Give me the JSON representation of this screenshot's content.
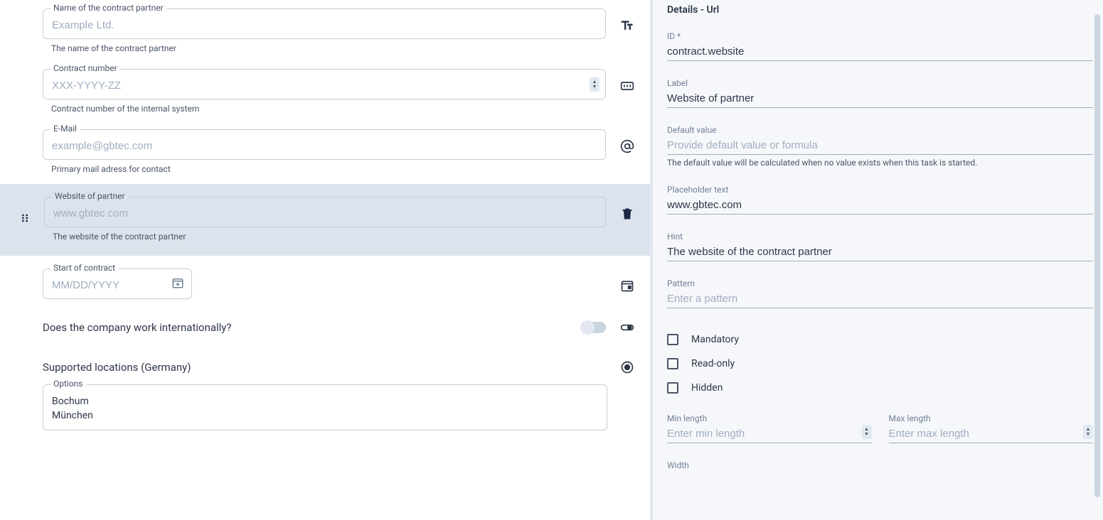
{
  "form": {
    "fields": [
      {
        "label": "Name of the contract partner",
        "placeholder": "Example Ltd.",
        "hint": "The name of the contract partner",
        "icon": "text-size-icon"
      },
      {
        "label": "Contract number",
        "placeholder": "XXX-YYYY-ZZ",
        "hint": "Contract number of the internal system",
        "icon": "number-icon"
      },
      {
        "label": "E-Mail",
        "placeholder": "example@gbtec.com",
        "hint": "Primary mail adress for contact",
        "icon": "at-icon"
      },
      {
        "label": "Website of partner",
        "placeholder": "www.gbtec.com",
        "hint": "The website of the contract partner",
        "icon": "trash-icon",
        "selected": true
      },
      {
        "label": "Start of contract",
        "placeholder": "MM/DD/YYYY",
        "icon": "calendar-icon"
      }
    ],
    "question": {
      "label": "Does the company work internationally?",
      "icon": "toggle-icon"
    },
    "section": {
      "label": "Supported locations (Germany)",
      "options_label": "Options",
      "options": [
        "Bochum",
        "München"
      ],
      "icon": "radio-icon"
    }
  },
  "details": {
    "title": "Details - Url",
    "id_label": "ID *",
    "id_value": "contract.website",
    "label_label": "Label",
    "label_value": "Website of partner",
    "default_label": "Default value",
    "default_placeholder": "Provide default value or formula",
    "default_hint": "The default value will be calculated when no value exists when this task is started.",
    "placeholder_label": "Placeholder text",
    "placeholder_value": "www.gbtec.com",
    "hint_label": "Hint",
    "hint_value": "The website of the contract partner",
    "pattern_label": "Pattern",
    "pattern_placeholder": "Enter a pattern",
    "mandatory_label": "Mandatory",
    "readonly_label": "Read-only",
    "hidden_label": "Hidden",
    "min_label": "Min length",
    "min_placeholder": "Enter min length",
    "max_label": "Max length",
    "max_placeholder": "Enter max length",
    "width_label": "Width"
  }
}
